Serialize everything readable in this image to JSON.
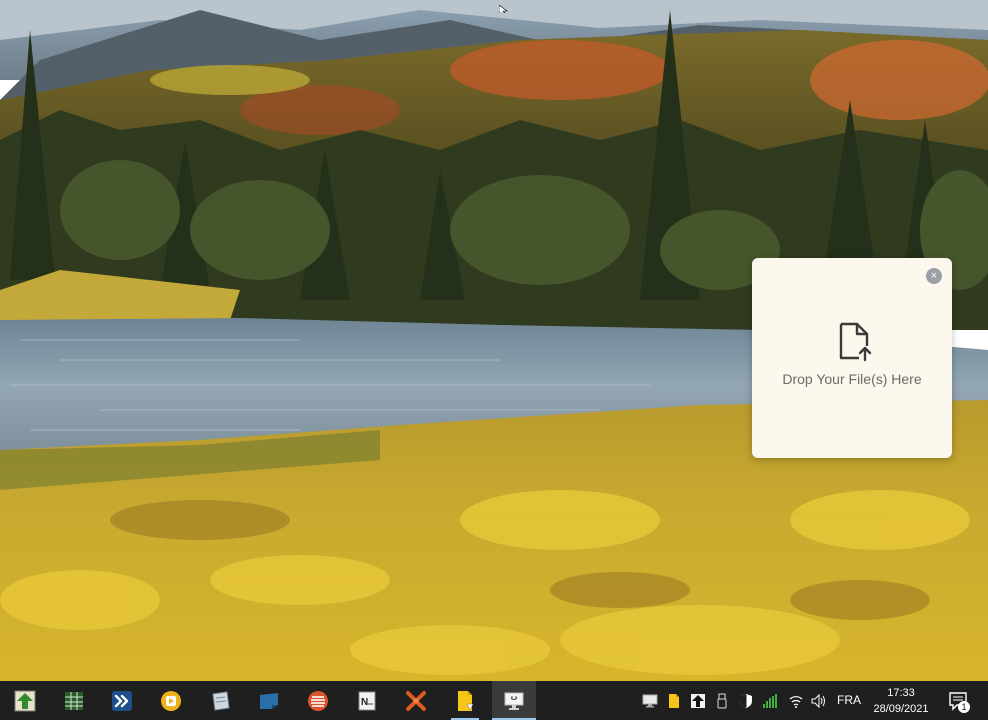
{
  "drop_zone": {
    "close_symbol": "×",
    "icon": "file-upload-icon",
    "text": "Drop Your File(s) Here"
  },
  "taskbar": {
    "apps": [
      {
        "name": "app-up-arrow",
        "icon": "green-up-arrow-icon"
      },
      {
        "name": "app-spreadsheet",
        "icon": "spreadsheet-icon"
      },
      {
        "name": "app-remote",
        "icon": "blue-arrows-icon"
      },
      {
        "name": "app-media-player",
        "icon": "play-circle-icon"
      },
      {
        "name": "app-notepad",
        "icon": "paper-icon"
      },
      {
        "name": "app-notes",
        "icon": "sticky-note-icon"
      },
      {
        "name": "app-list",
        "icon": "stacked-lines-icon"
      },
      {
        "name": "app-notebook",
        "icon": "notebook-icon"
      },
      {
        "name": "app-tools",
        "icon": "crossed-tools-icon"
      },
      {
        "name": "app-file-manager",
        "icon": "yellow-file-icon"
      },
      {
        "name": "app-active-window",
        "icon": "monitor-icon"
      }
    ],
    "tray": {
      "language": "FRA",
      "time": "17:33",
      "date": "28/09/2021",
      "notification_count": "1"
    }
  },
  "colors": {
    "taskbar_bg": "#1f1f1f",
    "panel_bg": "#fdf8ed",
    "accent": "#9ec7f0"
  }
}
